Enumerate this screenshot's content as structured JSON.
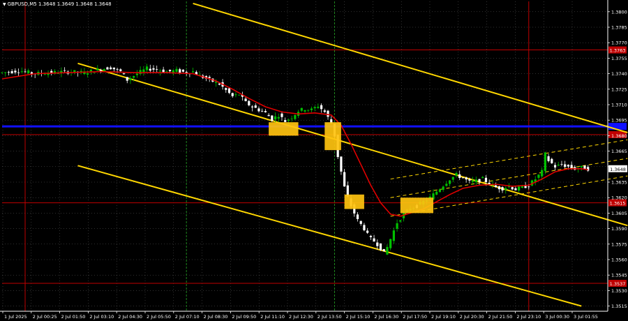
{
  "window": {
    "title": "GBPUSD,M5  1.3648 1.3649 1.3648 1.3648"
  },
  "colors": {
    "background": "#000000",
    "bull_candle": "#00c000",
    "bear_candle": "#ffffff",
    "ma": "#e00000",
    "channel": "#ffd700",
    "level_blue": "#1010ff",
    "level_red": "#c00000",
    "signal_box": "#ffc30f",
    "session_line_red": "#c00000",
    "session_line_green": "#1f8a1f",
    "grid": "#b4b4b4",
    "axis": "#ffffff",
    "price_tag": "#ffffff"
  },
  "chart_data": {
    "type": "candlestick",
    "symbol": "GBPUSD",
    "timeframe": "M5",
    "ohlc": {
      "open": 1.3648,
      "high": 1.3649,
      "low": 1.3648,
      "close": 1.3648
    },
    "ylim": [
      1.351,
      1.381
    ],
    "y_ticks": [
      1.38,
      1.3785,
      1.377,
      1.3755,
      1.374,
      1.3725,
      1.371,
      1.3695,
      1.368,
      1.3665,
      1.365,
      1.3635,
      1.362,
      1.3605,
      1.359,
      1.3575,
      1.356,
      1.3545,
      1.353,
      1.3515
    ],
    "x_ticks": [
      "1 Jul 2025",
      "2 Jul 00:25",
      "2 Jul 01:50",
      "2 Jul 03:10",
      "2 Jul 04:30",
      "2 Jul 05:50",
      "2 Jul 07:10",
      "2 Jul 08:30",
      "2 Jul 09:50",
      "2 Jul 11:10",
      "2 Jul 12:30",
      "2 Jul 13:50",
      "2 Jul 15:10",
      "2 Jul 16:30",
      "2 Jul 17:50",
      "2 Jul 19:10",
      "2 Jul 20:30",
      "2 Jul 21:50",
      "2 Jul 23:10",
      "3 Jul 00:30",
      "3 Jul 01:55"
    ],
    "x_span": [
      0,
      184
    ],
    "current_price": "1.3648",
    "horizontal_levels": [
      {
        "price": 1.3763,
        "label": "1.3763",
        "color": "red"
      },
      {
        "price": 1.3689,
        "label": "",
        "color": "blue"
      },
      {
        "price": 1.3681,
        "label": "",
        "color": "red"
      },
      {
        "price": 1.3615,
        "label": "1.3615",
        "color": "red"
      },
      {
        "price": 1.3537,
        "label": "1.3537",
        "color": "red"
      }
    ],
    "vertical_lines": [
      {
        "x": 7,
        "color": "red"
      },
      {
        "x": 56,
        "color": "green"
      },
      {
        "x": 101,
        "color": "green"
      },
      {
        "x": 160,
        "color": "red"
      }
    ],
    "channel_lines": [
      {
        "x1": 58,
        "y1": 1.3808,
        "x2": 190,
        "y2": 1.3683
      },
      {
        "x1": 23,
        "y1": 1.375,
        "x2": 190,
        "y2": 1.3593
      },
      {
        "x1": 23,
        "y1": 1.3651,
        "x2": 176,
        "y2": 1.3515
      }
    ],
    "dashed_channel": [
      {
        "x1": 118,
        "y1": 1.3638,
        "x2": 190,
        "y2": 1.3676
      },
      {
        "x1": 118,
        "y1": 1.362,
        "x2": 190,
        "y2": 1.3658
      },
      {
        "x1": 118,
        "y1": 1.3602,
        "x2": 190,
        "y2": 1.3641
      }
    ],
    "signal_boxes": [
      {
        "x0": 81,
        "x1": 90,
        "y_top": 1.3693,
        "y_bot": 1.368
      },
      {
        "x0": 98,
        "x1": 103,
        "y_top": 1.3693,
        "y_bot": 1.3666
      },
      {
        "x0": 104,
        "x1": 110,
        "y_top": 1.3623,
        "y_bot": 1.3609
      },
      {
        "x0": 121,
        "x1": 131,
        "y_top": 1.362,
        "y_bot": 1.3605
      }
    ],
    "price_path": [
      [
        0,
        1.3741
      ],
      [
        5,
        1.3743
      ],
      [
        10,
        1.374
      ],
      [
        15,
        1.3741
      ],
      [
        20,
        1.3742
      ],
      [
        25,
        1.3741
      ],
      [
        28,
        1.3743
      ],
      [
        31,
        1.3745
      ],
      [
        33,
        1.3746
      ],
      [
        36,
        1.3742
      ],
      [
        38,
        1.3734
      ],
      [
        41,
        1.374
      ],
      [
        44,
        1.3745
      ],
      [
        47,
        1.3744
      ],
      [
        50,
        1.3742
      ],
      [
        53,
        1.3743
      ],
      [
        56,
        1.3741
      ],
      [
        58,
        1.3742
      ],
      [
        60,
        1.3738
      ],
      [
        63,
        1.3734
      ],
      [
        66,
        1.373
      ],
      [
        68,
        1.3724
      ],
      [
        70,
        1.3718
      ],
      [
        72,
        1.372
      ],
      [
        74,
        1.3712
      ],
      [
        76,
        1.3708
      ],
      [
        78,
        1.3705
      ],
      [
        80,
        1.3702
      ],
      [
        82,
        1.3696
      ],
      [
        84,
        1.37
      ],
      [
        86,
        1.3694
      ],
      [
        88,
        1.3698
      ],
      [
        90,
        1.3704
      ],
      [
        92,
        1.3706
      ],
      [
        94,
        1.3705
      ],
      [
        96,
        1.3709
      ],
      [
        98,
        1.3703
      ],
      [
        100,
        1.3692
      ],
      [
        101,
        1.368
      ],
      [
        102,
        1.366
      ],
      [
        103,
        1.3645
      ],
      [
        104,
        1.363
      ],
      [
        105,
        1.362
      ],
      [
        106,
        1.3612
      ],
      [
        107,
        1.3605
      ],
      [
        108,
        1.3598
      ],
      [
        109,
        1.3594
      ],
      [
        110,
        1.359
      ],
      [
        111,
        1.3584
      ],
      [
        112,
        1.358
      ],
      [
        113,
        1.3578
      ],
      [
        114,
        1.3575
      ],
      [
        115,
        1.3571
      ],
      [
        116,
        1.3566
      ],
      [
        117,
        1.3572
      ],
      [
        118,
        1.358
      ],
      [
        119,
        1.3588
      ],
      [
        120,
        1.3596
      ],
      [
        122,
        1.3604
      ],
      [
        124,
        1.361
      ],
      [
        126,
        1.3612
      ],
      [
        128,
        1.3616
      ],
      [
        130,
        1.362
      ],
      [
        132,
        1.3626
      ],
      [
        134,
        1.3632
      ],
      [
        136,
        1.3638
      ],
      [
        138,
        1.3642
      ],
      [
        140,
        1.3639
      ],
      [
        142,
        1.3635
      ],
      [
        144,
        1.3636
      ],
      [
        146,
        1.3638
      ],
      [
        148,
        1.3634
      ],
      [
        150,
        1.363
      ],
      [
        152,
        1.3629
      ],
      [
        154,
        1.3631
      ],
      [
        156,
        1.3628
      ],
      [
        158,
        1.363
      ],
      [
        160,
        1.3632
      ],
      [
        162,
        1.3638
      ],
      [
        164,
        1.3645
      ],
      [
        165,
        1.3662
      ],
      [
        166,
        1.3656
      ],
      [
        168,
        1.365
      ],
      [
        170,
        1.3652
      ],
      [
        172,
        1.365
      ],
      [
        174,
        1.3648
      ],
      [
        176,
        1.3649
      ],
      [
        178,
        1.3648
      ]
    ],
    "ma_path": [
      [
        0,
        1.3735
      ],
      [
        10,
        1.374
      ],
      [
        20,
        1.3741
      ],
      [
        30,
        1.3742
      ],
      [
        40,
        1.3741
      ],
      [
        50,
        1.3741
      ],
      [
        58,
        1.374
      ],
      [
        65,
        1.3733
      ],
      [
        70,
        1.3725
      ],
      [
        75,
        1.3716
      ],
      [
        80,
        1.3708
      ],
      [
        85,
        1.3703
      ],
      [
        90,
        1.3701
      ],
      [
        95,
        1.3702
      ],
      [
        100,
        1.37
      ],
      [
        103,
        1.369
      ],
      [
        106,
        1.3672
      ],
      [
        109,
        1.3652
      ],
      [
        112,
        1.3632
      ],
      [
        115,
        1.3615
      ],
      [
        118,
        1.3604
      ],
      [
        121,
        1.3602
      ],
      [
        124,
        1.3605
      ],
      [
        128,
        1.3609
      ],
      [
        132,
        1.3616
      ],
      [
        136,
        1.3623
      ],
      [
        140,
        1.3629
      ],
      [
        145,
        1.3632
      ],
      [
        150,
        1.3633
      ],
      [
        155,
        1.3631
      ],
      [
        160,
        1.3632
      ],
      [
        164,
        1.3638
      ],
      [
        168,
        1.3645
      ],
      [
        172,
        1.3648
      ],
      [
        176,
        1.3648
      ],
      [
        178,
        1.3647
      ]
    ]
  }
}
